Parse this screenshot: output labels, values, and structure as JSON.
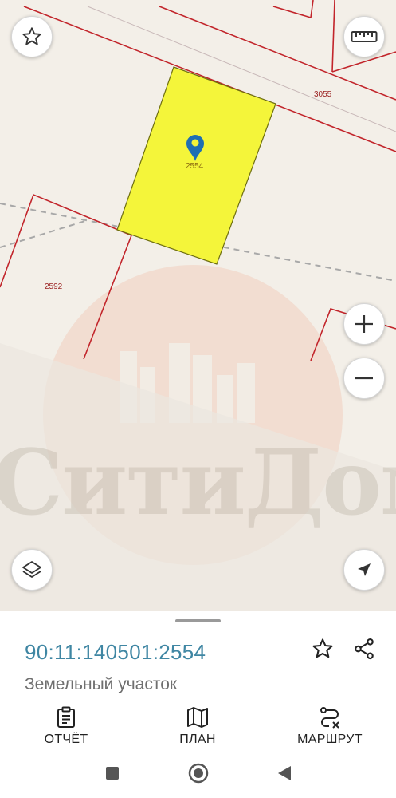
{
  "map": {
    "watermark": "СитиДом",
    "parcel_labels": {
      "selected": "2554",
      "top_right": "3055",
      "left": "2592"
    },
    "buttons": {
      "favorite_icon": "star-outline",
      "ruler_icon": "ruler",
      "zoom_in_icon": "plus",
      "zoom_out_icon": "minus",
      "layers_icon": "layers",
      "locate_icon": "navigation-arrow"
    },
    "colors": {
      "parcel_border": "#c2252b",
      "selected_fill": "#f4f53a",
      "selected_border": "#6e6e10",
      "marker": "#1f6fb2",
      "road_dash": "#a8a8a8"
    }
  },
  "sheet": {
    "cadastral_number": "90:11:140501:2554",
    "object_type": "Земельный участок",
    "actions": [
      {
        "label": "ОТЧЁТ",
        "icon": "clipboard-list"
      },
      {
        "label": "ПЛАН",
        "icon": "map-folded"
      },
      {
        "label": "МАРШРУТ",
        "icon": "route"
      }
    ]
  },
  "system_nav": {
    "recents_icon": "square",
    "home_icon": "circle",
    "back_icon": "triangle-left"
  }
}
